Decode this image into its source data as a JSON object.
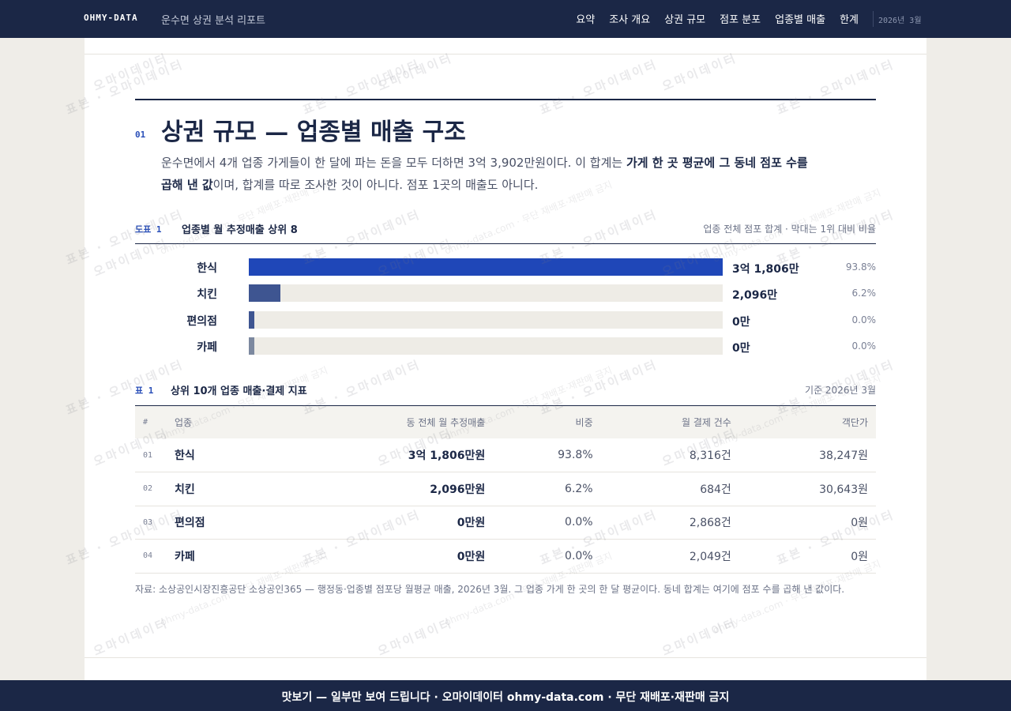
{
  "header": {
    "brand": "OHMY-DATA",
    "report_title": "운수면 상권 분석 리포트",
    "nav": [
      "요약",
      "조사 개요",
      "상권 규모",
      "점포 분포",
      "업종별 매출",
      "한계"
    ],
    "date": "2026년 3월"
  },
  "section": {
    "number": "01",
    "title": "상권 규모 — 업종별 매출 구조",
    "lead_part1": "운수면에서 4개 업종 가게들이 한 달에 파는 돈을 모두 더하면 3억 3,902만원이다. 이 합계는 ",
    "lead_bold": "가게 한 곳 평균에 그 동네 점포 수를 곱해 낸 값",
    "lead_part2": "이며, 합계를 따로 조사한 것이 아니다. 점포 1곳의 매출도 아니다."
  },
  "figure": {
    "label": "도표 1",
    "title": "업종별 월 추정매출 상위 8",
    "note": "업종 전체 점포 합계 · 막대는 1위 대비 비율",
    "bars": [
      {
        "label": "한식",
        "value": "3억 1,806만",
        "pct": "93.8%"
      },
      {
        "label": "치킨",
        "value": "2,096만",
        "pct": "6.2%"
      },
      {
        "label": "편의점",
        "value": "0만",
        "pct": "0.0%"
      },
      {
        "label": "카페",
        "value": "0만",
        "pct": "0.0%"
      }
    ]
  },
  "chart_data": {
    "type": "bar",
    "categories": [
      "한식",
      "치킨",
      "편의점",
      "카페"
    ],
    "values": [
      31806,
      2096,
      0,
      0
    ],
    "unit": "만원",
    "ylim": [
      0,
      31806
    ]
  },
  "table": {
    "label": "표 1",
    "title": "상위 10개 업종 매출·결제 지표",
    "note": "기준 2026년 3월",
    "headers": [
      "#",
      "업종",
      "동 전체 월 추정매출",
      "비중",
      "월 결제 건수",
      "객단가"
    ],
    "rows": [
      [
        "01",
        "한식",
        "3억 1,806만원",
        "93.8%",
        "8,316건",
        "38,247원"
      ],
      [
        "02",
        "치킨",
        "2,096만원",
        "6.2%",
        "684건",
        "30,643원"
      ],
      [
        "03",
        "편의점",
        "0만원",
        "0.0%",
        "2,868건",
        "0원"
      ],
      [
        "04",
        "카페",
        "0만원",
        "0.0%",
        "2,049건",
        "0원"
      ]
    ]
  },
  "source": "자료: 소상공인시장진흥공단 소상공인365 — 행정동·업종별 점포당 월평균 매출, 2026년 3월. 그 업종 가게 한 곳의 한 달 평균이다. 동네 합계는 여기에 점포 수를 곱해 낸 값이다.",
  "footer": "맛보기 — 일부만 보여 드립니다 · 오마이데이터 ohmy-data.com · 무단 재배포·재판매 금지",
  "watermark": {
    "main": "표본 · 오마이데이터",
    "alt": "오마이데이터",
    "sub": "ohmy-data.com · 무단 재배포·재판매 금지"
  },
  "colors": {
    "navy": "#1b2746",
    "bars": [
      "#1f47b8",
      "#3e5591",
      "#3e5591",
      "#7c889f"
    ]
  }
}
